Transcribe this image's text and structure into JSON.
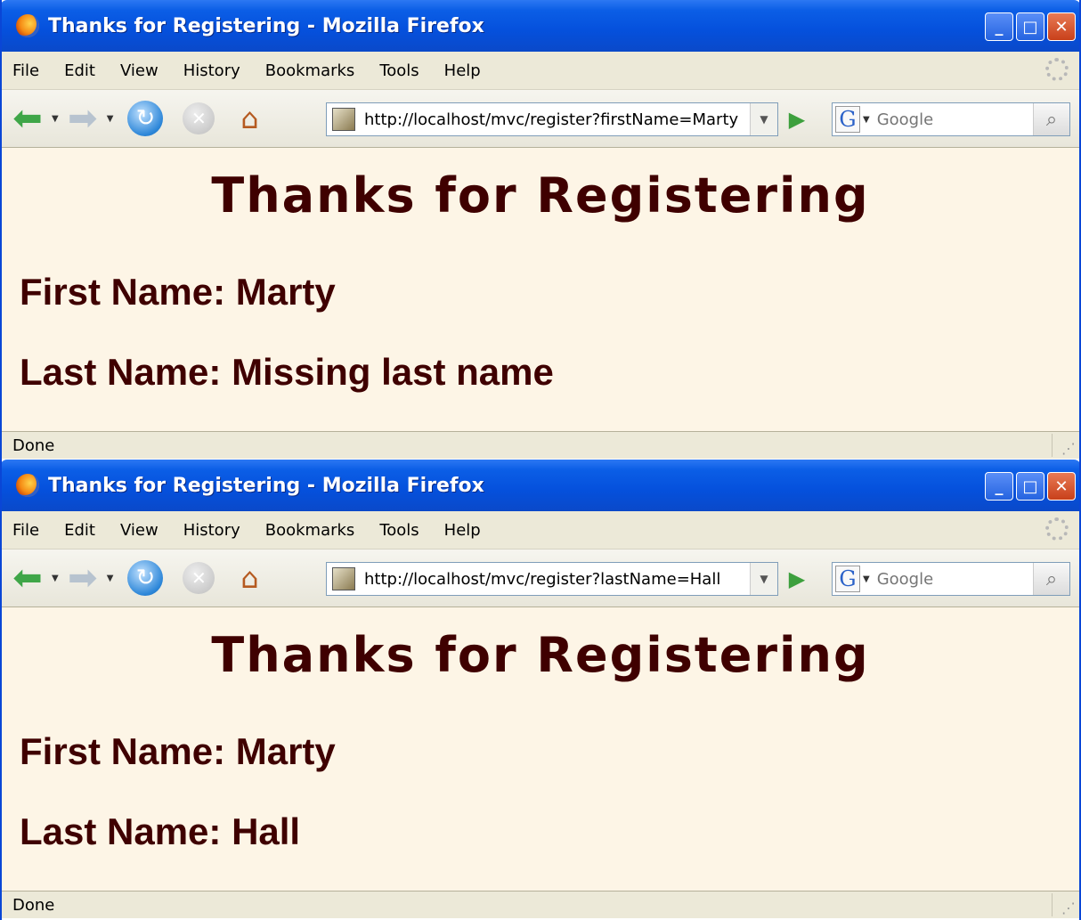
{
  "windows": [
    {
      "title": "Thanks for Registering - Mozilla Firefox",
      "menu": [
        "File",
        "Edit",
        "View",
        "History",
        "Bookmarks",
        "Tools",
        "Help"
      ],
      "url": "http://localhost/mvc/register?firstName=Marty",
      "search_placeholder": "Google",
      "page": {
        "heading": "Thanks for Registering",
        "first_name_line": "First Name: Marty",
        "last_name_line": "Last Name: Missing last name"
      },
      "status": "Done"
    },
    {
      "title": "Thanks for Registering - Mozilla Firefox",
      "menu": [
        "File",
        "Edit",
        "View",
        "History",
        "Bookmarks",
        "Tools",
        "Help"
      ],
      "url": "http://localhost/mvc/register?lastName=Hall",
      "search_placeholder": "Google",
      "page": {
        "heading": "Thanks for Registering",
        "first_name_line": "First Name: Marty",
        "last_name_line": "Last Name: Hall"
      },
      "status": "Done"
    }
  ],
  "icons": {
    "window_buttons": [
      "minimize-icon",
      "maximize-icon",
      "close-icon"
    ],
    "nav": [
      "back-icon",
      "forward-icon",
      "reload-icon",
      "stop-icon",
      "home-icon",
      "go-icon",
      "search-icon"
    ]
  },
  "colors": {
    "page_background": "#fdf5e6",
    "page_text": "#3f0000",
    "titlebar": "#0550dc"
  }
}
